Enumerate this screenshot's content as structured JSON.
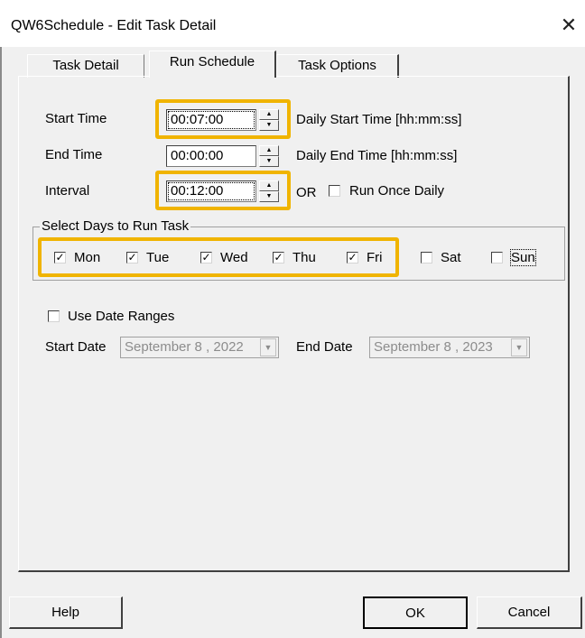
{
  "window": {
    "title": "QW6Schedule - Edit Task Detail",
    "close_glyph": "✕"
  },
  "tabs": [
    {
      "label": "Task Detail",
      "active": false
    },
    {
      "label": "Run Schedule",
      "active": true
    },
    {
      "label": "Task Options",
      "active": false
    }
  ],
  "schedule": {
    "start_time": {
      "label": "Start Time",
      "value": "00:07:00",
      "hint": "Daily Start Time [hh:mm:ss]"
    },
    "end_time": {
      "label": "End Time",
      "value": "00:00:00",
      "hint": "Daily End Time [hh:mm:ss]"
    },
    "interval": {
      "label": "Interval",
      "value": "00:12:00",
      "or_label": "OR"
    },
    "run_once": {
      "label": "Run Once Daily",
      "checked": false
    }
  },
  "days": {
    "group_label": "Select Days to Run Task",
    "items": [
      {
        "label": "Mon",
        "checked": true
      },
      {
        "label": "Tue",
        "checked": true
      },
      {
        "label": "Wed",
        "checked": true
      },
      {
        "label": "Thu",
        "checked": true
      },
      {
        "label": "Fri",
        "checked": true
      },
      {
        "label": "Sat",
        "checked": false
      },
      {
        "label": "Sun",
        "checked": false
      }
    ]
  },
  "date_ranges": {
    "use_label": "Use Date Ranges",
    "checked": false,
    "start_label": "Start Date",
    "start_value": "September  8 , 2022",
    "end_label": "End Date",
    "end_value": "September  8 , 2023"
  },
  "buttons": {
    "help": "Help",
    "ok": "OK",
    "cancel": "Cancel"
  },
  "glyphs": {
    "check": "✓",
    "spin_up": "▲",
    "spin_down": "▼",
    "combo_arrow": "▼"
  },
  "colors": {
    "highlight": "#f0b400",
    "dialog_bg": "#f0f0f0"
  }
}
